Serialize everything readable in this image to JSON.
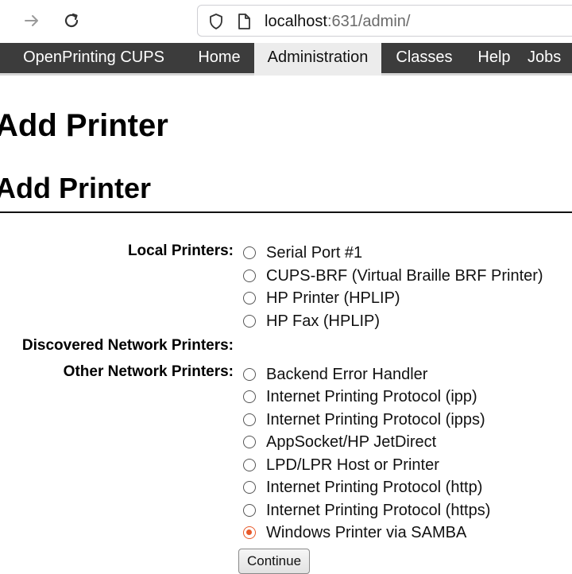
{
  "browser": {
    "url_host": "localhost",
    "url_rest": ":631/admin/"
  },
  "nav": {
    "items": [
      {
        "label": "OpenPrinting CUPS"
      },
      {
        "label": "Home"
      },
      {
        "label": "Administration",
        "active": true
      },
      {
        "label": "Classes"
      },
      {
        "label": "Help"
      },
      {
        "label": "Jobs"
      }
    ]
  },
  "page": {
    "title": "Add Printer",
    "heading": "Add Printer"
  },
  "form": {
    "local_label": "Local Printers:",
    "local_options": [
      {
        "label": "Serial Port #1"
      },
      {
        "label": "CUPS-BRF (Virtual Braille BRF Printer)"
      },
      {
        "label": "HP Printer (HPLIP)"
      },
      {
        "label": "HP Fax (HPLIP)"
      }
    ],
    "discovered_label": "Discovered Network Printers:",
    "other_label": "Other Network Printers:",
    "other_options": [
      {
        "label": "Backend Error Handler"
      },
      {
        "label": "Internet Printing Protocol (ipp)"
      },
      {
        "label": "Internet Printing Protocol (ipps)"
      },
      {
        "label": "AppSocket/HP JetDirect"
      },
      {
        "label": "LPD/LPR Host or Printer"
      },
      {
        "label": "Internet Printing Protocol (http)"
      },
      {
        "label": "Internet Printing Protocol (https)"
      },
      {
        "label": "Windows Printer via SAMBA",
        "selected": true
      }
    ],
    "continue_label": "Continue"
  },
  "colors": {
    "nav_bg": "#3c3c3c",
    "nav_active_bg": "#ececec",
    "radio_selected": "#e85a2a"
  },
  "icons": {
    "forward": "forward-arrow-icon",
    "reload": "reload-icon",
    "shield": "shield-icon",
    "page": "page-icon"
  }
}
